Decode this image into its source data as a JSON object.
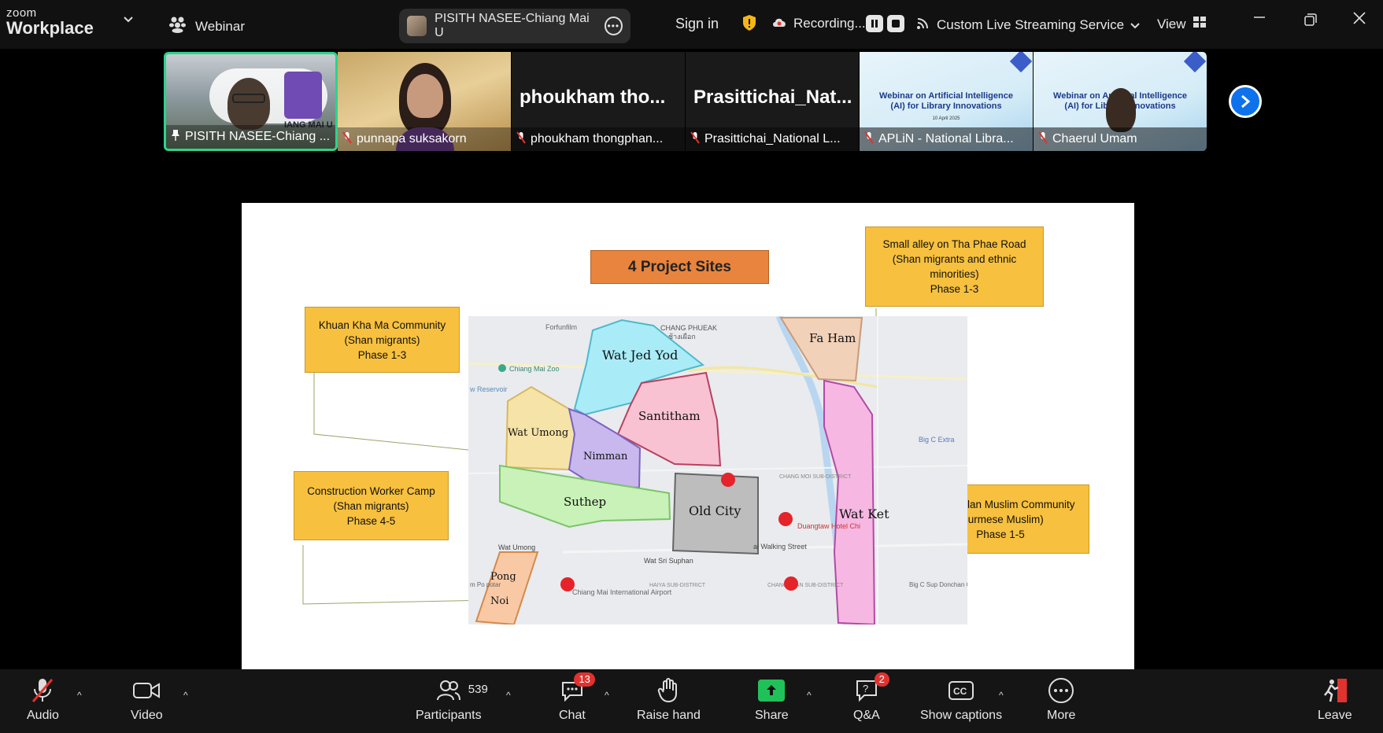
{
  "app": {
    "logo_top": "zoom",
    "logo_bottom": "Workplace",
    "mode_label": "Webinar",
    "meeting_name": "PISITH NASEE-Chiang Mai U",
    "sign_in": "Sign in",
    "recording": "Recording...",
    "streaming": "Custom Live Streaming Service",
    "view": "View"
  },
  "thumbnails": [
    {
      "name": "PISITH NASEE-Chiang ...",
      "muted": false,
      "pinned": true,
      "overlay": "IANG MAI U"
    },
    {
      "name": "punnapa suksakorn",
      "muted": true
    },
    {
      "name": "phoukham thongphan...",
      "muted": true,
      "big_name": "phoukham tho..."
    },
    {
      "name": "Prasittichai_National L...",
      "muted": true,
      "big_name": "Prasittichai_Nat..."
    },
    {
      "name": "APLiN - National Libra...",
      "muted": true,
      "slide_title": "Webinar on Artificial Intelligence (AI) for Library Innovations",
      "slide_date": "10 April 2025"
    },
    {
      "name": "Chaerul Umam",
      "muted": true,
      "slide_title": "Webinar on Artificial Intelligence (AI) for Library Innovations"
    }
  ],
  "slide": {
    "title": "4 Project Sites",
    "labels": {
      "khuan": [
        "Khuan Kha Ma Community",
        "(Shan migrants)",
        "Phase 1-3"
      ],
      "alley": [
        "Small alley on Tha Phae Road",
        "(Shan migrants and ethnic",
        "minorities)",
        "Phase 1-3"
      ],
      "construction": [
        "Construction Worker Camp",
        "(Shan migrants)",
        "Phase 4-5"
      ],
      "changklan": [
        "Chang Klan Muslim Community",
        "(Burmese Muslim)",
        "Phase 1-5"
      ]
    },
    "map": {
      "areas": {
        "wat_jed_yod": "Wat Jed Yod",
        "fa_ham": "Fa Ham",
        "santitham": "Santitham",
        "wat_umong_area": "Wat Umong",
        "nimman": "Nimman",
        "suthep": "Suthep",
        "old_city": "Old City",
        "wat_ket": "Wat Ket",
        "pong": "Pong",
        "noi": "Noi"
      },
      "places": {
        "forfunfilm": "Forfunfilm",
        "chang_phueak": "CHANG PHUEAK",
        "chang_phueak_th": "ช้างเผือก",
        "zoo": "Chiang Mai Zoo",
        "reservoir": "w Reservoir",
        "wat_umong_poi": "Wat Umong",
        "wat_sri_suphan": "Wat Sri Suphan",
        "walking_street": "ai Walking Street",
        "airport": "Chiang Mai International Airport",
        "bigc": "Big C Extra",
        "bigc2": "Big C Sup Donchan Ch",
        "duangtawan": "Duangtaw Hotel Chi",
        "pongpot": "m Po potar",
        "changmoi": "CHANG MOI SUB-DISTRICT",
        "haiya": "HAIYA SUB-DISTRICT",
        "changklan_sd": "CHANG KLAN SUB-DISTRICT"
      }
    }
  },
  "bottom": {
    "audio": "Audio",
    "video": "Video",
    "participants": "Participants",
    "participants_count": "539",
    "chat": "Chat",
    "chat_badge": "13",
    "raise_hand": "Raise hand",
    "share": "Share",
    "qa": "Q&A",
    "qa_badge": "2",
    "captions": "Show captions",
    "more": "More",
    "leave": "Leave"
  }
}
